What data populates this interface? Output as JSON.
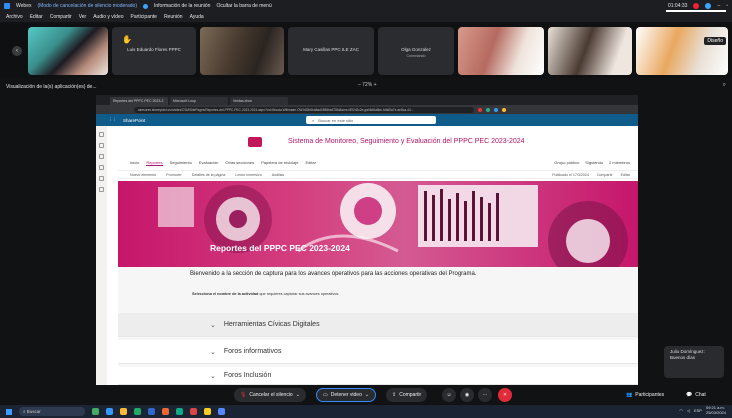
{
  "title_bar": {
    "app": "Webex",
    "mode": "(Modo de cancelación de silencio moderado)",
    "info": "Información de la reunión",
    "hide_bar": "Ocultar la barra de menú",
    "time": "01:04:33"
  },
  "menu": [
    "Archivo",
    "Editar",
    "Compartir",
    "Ver",
    "Audio y vídeo",
    "Participante",
    "Reunión",
    "Ayuda"
  ],
  "participants": [
    {
      "name": "",
      "sub": ""
    },
    {
      "name": "Luis Eduardo Flores PPPC",
      "sub": ""
    },
    {
      "name": "",
      "sub": ""
    },
    {
      "name": "Mary Casillas PPC ILE ZAC",
      "sub": ""
    },
    {
      "name": "Olga Gonzalez",
      "sub": "Conectando"
    },
    {
      "name": "",
      "sub": ""
    },
    {
      "name": "",
      "sub": ""
    },
    {
      "name": "",
      "sub": ""
    }
  ],
  "layout_button": "Diseño",
  "share": {
    "label": "Visualización de la(s) aplicación(es) de...",
    "zoom": "72%"
  },
  "browser": {
    "tabs": [
      "Reportes del PPPC PEC 2023-2",
      "Microsoft Loop",
      "Ventas.xlsm"
    ],
    "url": "asesores.sharepoint.com/sites/CSM/SitePages/Reportes-del-PPPC-PEC-2023-2024.aspx?cid=Bnuda.Wtlfmatm.OW.b82b6ba8ad0558ba678fd&sms=892d2c2e-gah6d6a8bc-fdb65a7e-ae8ca-44..."
  },
  "sharepoint": {
    "app": "SharePoint",
    "search_placeholder": "Buscar en este sitio",
    "site_title": "Sistema de Monitoreo, Seguimiento y Evaluación del PPPC PEC 2023-2024",
    "nav": [
      "Inicio",
      "Reportes",
      "Seguimiento",
      "Evaluación",
      "Otras secciones",
      "Papelera de reciclaje",
      "Editar"
    ],
    "nav_right": [
      "Grupo público",
      "Siguiendo",
      "2 miembros"
    ],
    "cmd": [
      "Nuevo elemento",
      "Promover",
      "Detalles de la página",
      "Lector inmersivo",
      "Análisis"
    ],
    "cmd_right": [
      "Publicado el 17/3/2024",
      "Compartir",
      "Editar"
    ],
    "hero_title": "Reportes del PPPC PEC 2023-2024",
    "welcome": "Bienvenido a la sección de captura para los avances operativos para las acciones operativas del Programa.",
    "instruction_bold": "Selecciona el nombre de la actividad",
    "instruction_rest": " que requieres capturar sus avances operativos.",
    "sections": [
      "Herramientas Cívicas Digitales",
      "Foros informativos",
      "Foros Inclusión"
    ]
  },
  "chat_preview": {
    "name": "Julio Domínguez:",
    "message": "Buenos días"
  },
  "controls": {
    "mute": "Cancelar el silencio",
    "video": "Detener video",
    "share": "Compartir",
    "participants": "Participantes",
    "chat": "Chat"
  },
  "taskbar": {
    "search": "Buscar",
    "lang": "ESP",
    "time": "09:21 a.m.",
    "date": "25/03/2024"
  },
  "colors": {
    "brand": "#b01569",
    "sp_blue": "#0f5c8a",
    "end_call": "#e22b3a"
  }
}
